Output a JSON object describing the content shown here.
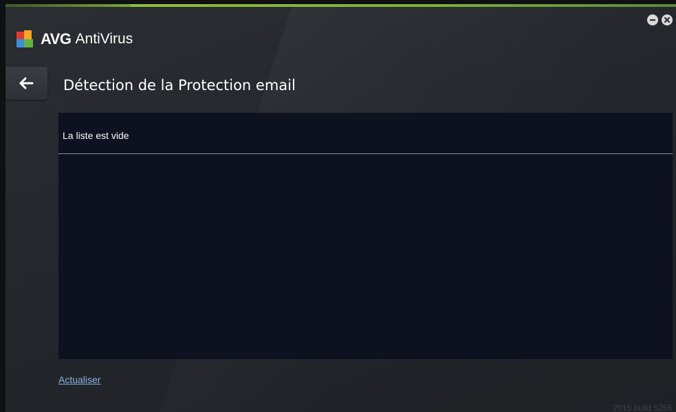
{
  "app": {
    "brand": "AVG",
    "product": "AntiVirus"
  },
  "window_controls": {
    "minimize_icon": "minus-icon",
    "close_icon": "close-icon"
  },
  "navigation": {
    "back_icon": "arrow-left-icon"
  },
  "page": {
    "title": "Détection de la Protection email"
  },
  "list": {
    "empty_message": "La liste est vide"
  },
  "actions": {
    "refresh_label": "Actualiser"
  },
  "footer": {
    "build": "2015  build 5256"
  },
  "colors": {
    "accent_green": "#8fbf3a",
    "link_blue": "#86b3e6",
    "panel_bg": "#0d1120"
  }
}
